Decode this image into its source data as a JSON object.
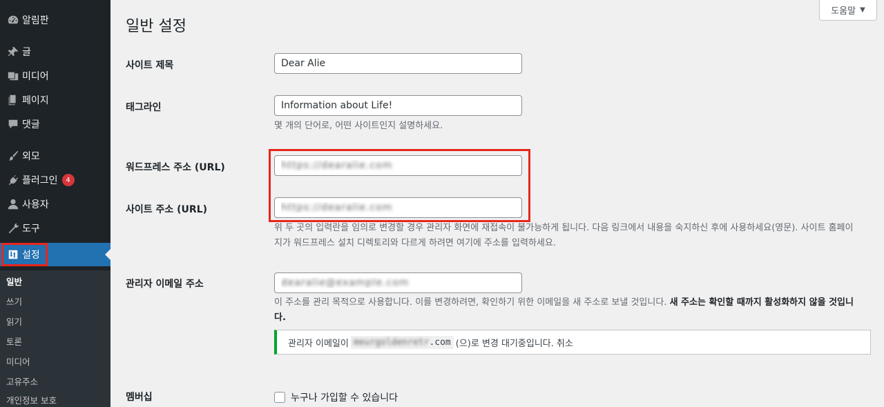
{
  "sidebar": {
    "items": [
      {
        "label": "알림판",
        "icon": "dashboard-icon"
      },
      {
        "label": "글",
        "icon": "pin-icon"
      },
      {
        "label": "미디어",
        "icon": "media-icon"
      },
      {
        "label": "페이지",
        "icon": "page-icon"
      },
      {
        "label": "댓글",
        "icon": "comment-icon"
      },
      {
        "label": "외모",
        "icon": "brush-icon"
      },
      {
        "label": "플러그인",
        "icon": "plugin-icon",
        "badge": "4"
      },
      {
        "label": "사용자",
        "icon": "user-icon"
      },
      {
        "label": "도구",
        "icon": "wrench-icon"
      },
      {
        "label": "설정",
        "icon": "settings-icon"
      }
    ],
    "submenu": [
      "일반",
      "쓰기",
      "읽기",
      "토론",
      "미디어",
      "고유주소",
      "개인정보 보호"
    ]
  },
  "header": {
    "title": "일반 설정",
    "help_label": "도움말"
  },
  "form": {
    "site_title_label": "사이트 제목",
    "site_title_value": "Dear Alie",
    "tagline_label": "태그라인",
    "tagline_value": "Information about Life!",
    "tagline_desc": "몇 개의 단어로, 어떤 사이트인지 설명하세요.",
    "wp_url_label": "워드프레스 주소 (URL)",
    "wp_url_value": "https://dearalie.com",
    "site_url_label": "사이트 주소 (URL)",
    "site_url_value": "https://dearalie.com",
    "url_desc_line1": "위 두 곳의 입력란을 임의로 변경할 경우 관리자 화면에 재접속이 불가능하게 됩니다. 다음 링크에서 내용을 숙지하신 후에 사용하세요(영문). 사이트 홈페이",
    "url_desc_line2": "지가 워드프레스 설치 디렉토리와 다르게 하려면 여기에 주소를 입력하세요.",
    "admin_email_label": "관리자 이메일 주소",
    "admin_email_value": "dearalie@example.com",
    "email_desc_normal": "이 주소를 관리 목적으로 사용합니다. 이를 변경하려면, 확인하기 위한 이메일을 새 주소로 보낼 것입니다. ",
    "email_desc_bold": "새 주소는 확인할 때까지 활성화하지 않을 것입니",
    "email_desc_bold2": "다.",
    "notice_prefix": "관리자 이메일이",
    "notice_email_blur": "meurgoldenretr",
    "notice_email_suffix": ".com",
    "notice_suffix": "(으)로 변경 대기중입니다.",
    "notice_cancel": "취소",
    "membership_label": "멤버십",
    "membership_checkbox_label": "누구나 가입할 수 있습니다"
  },
  "colors": {
    "sidebar_bg": "#1d2327",
    "active_bg": "#2271b1",
    "highlight_red": "#e8261b",
    "notice_green": "#00a32a"
  }
}
